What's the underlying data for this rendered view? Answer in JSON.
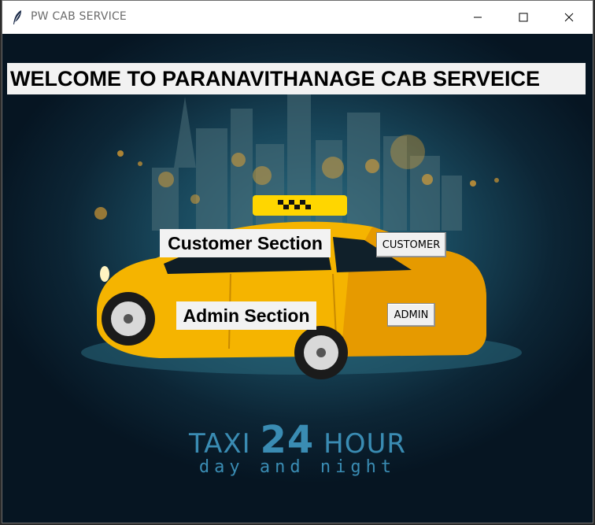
{
  "window": {
    "title": "PW CAB SERVICE",
    "controls": [
      "minimize-icon",
      "maximize-icon",
      "close-icon"
    ]
  },
  "main": {
    "heading": "WELCOME TO PARANAVITHANAGE CAB SERVEICE",
    "customer_label": "Customer Section",
    "customer_button": "CUSTOMER",
    "admin_label": "Admin Section",
    "admin_button": "ADMIN"
  },
  "background": {
    "brand_prefix": "TAXI",
    "brand_number": "24",
    "brand_suffix": "HOUR",
    "tagline": "day and night",
    "colors": {
      "taxi_yellow": "#f5b400",
      "sign_yellow": "#ffd600",
      "bg_teal": "#18465a",
      "brand_blue": "#3a8cb3"
    }
  }
}
